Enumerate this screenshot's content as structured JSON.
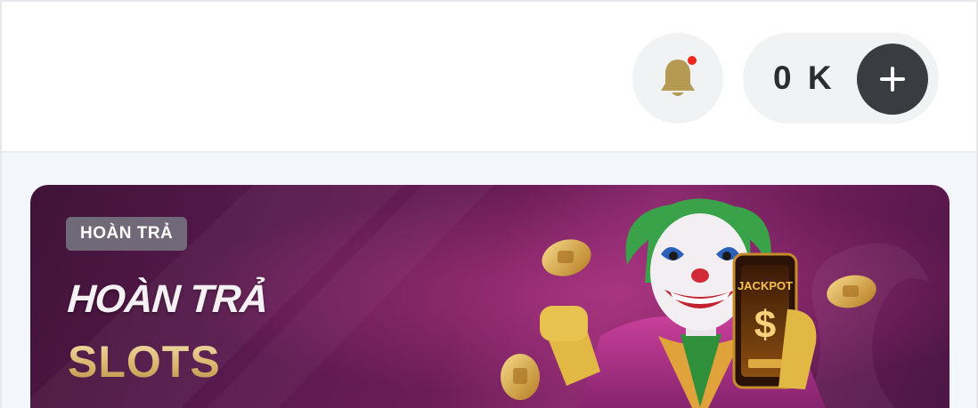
{
  "header": {
    "notification": {
      "icon": "bell-icon",
      "has_unread": true
    },
    "balance": {
      "text": "0 K",
      "add_icon": "plus-icon"
    }
  },
  "banner": {
    "badge": "HOÀN TRẢ",
    "title": "HOÀN TRẢ",
    "subtitle": "SLOTS",
    "phone_text": "JACKPOT"
  },
  "colors": {
    "page_bg": "#f3f6fb",
    "header_bg": "#ffffff",
    "pill_bg": "#f1f2f4",
    "add_button": "#3a3c41",
    "notification_dot": "#f2271c",
    "banner_purple": "#6b1d58",
    "gold": "#d7b26a"
  }
}
